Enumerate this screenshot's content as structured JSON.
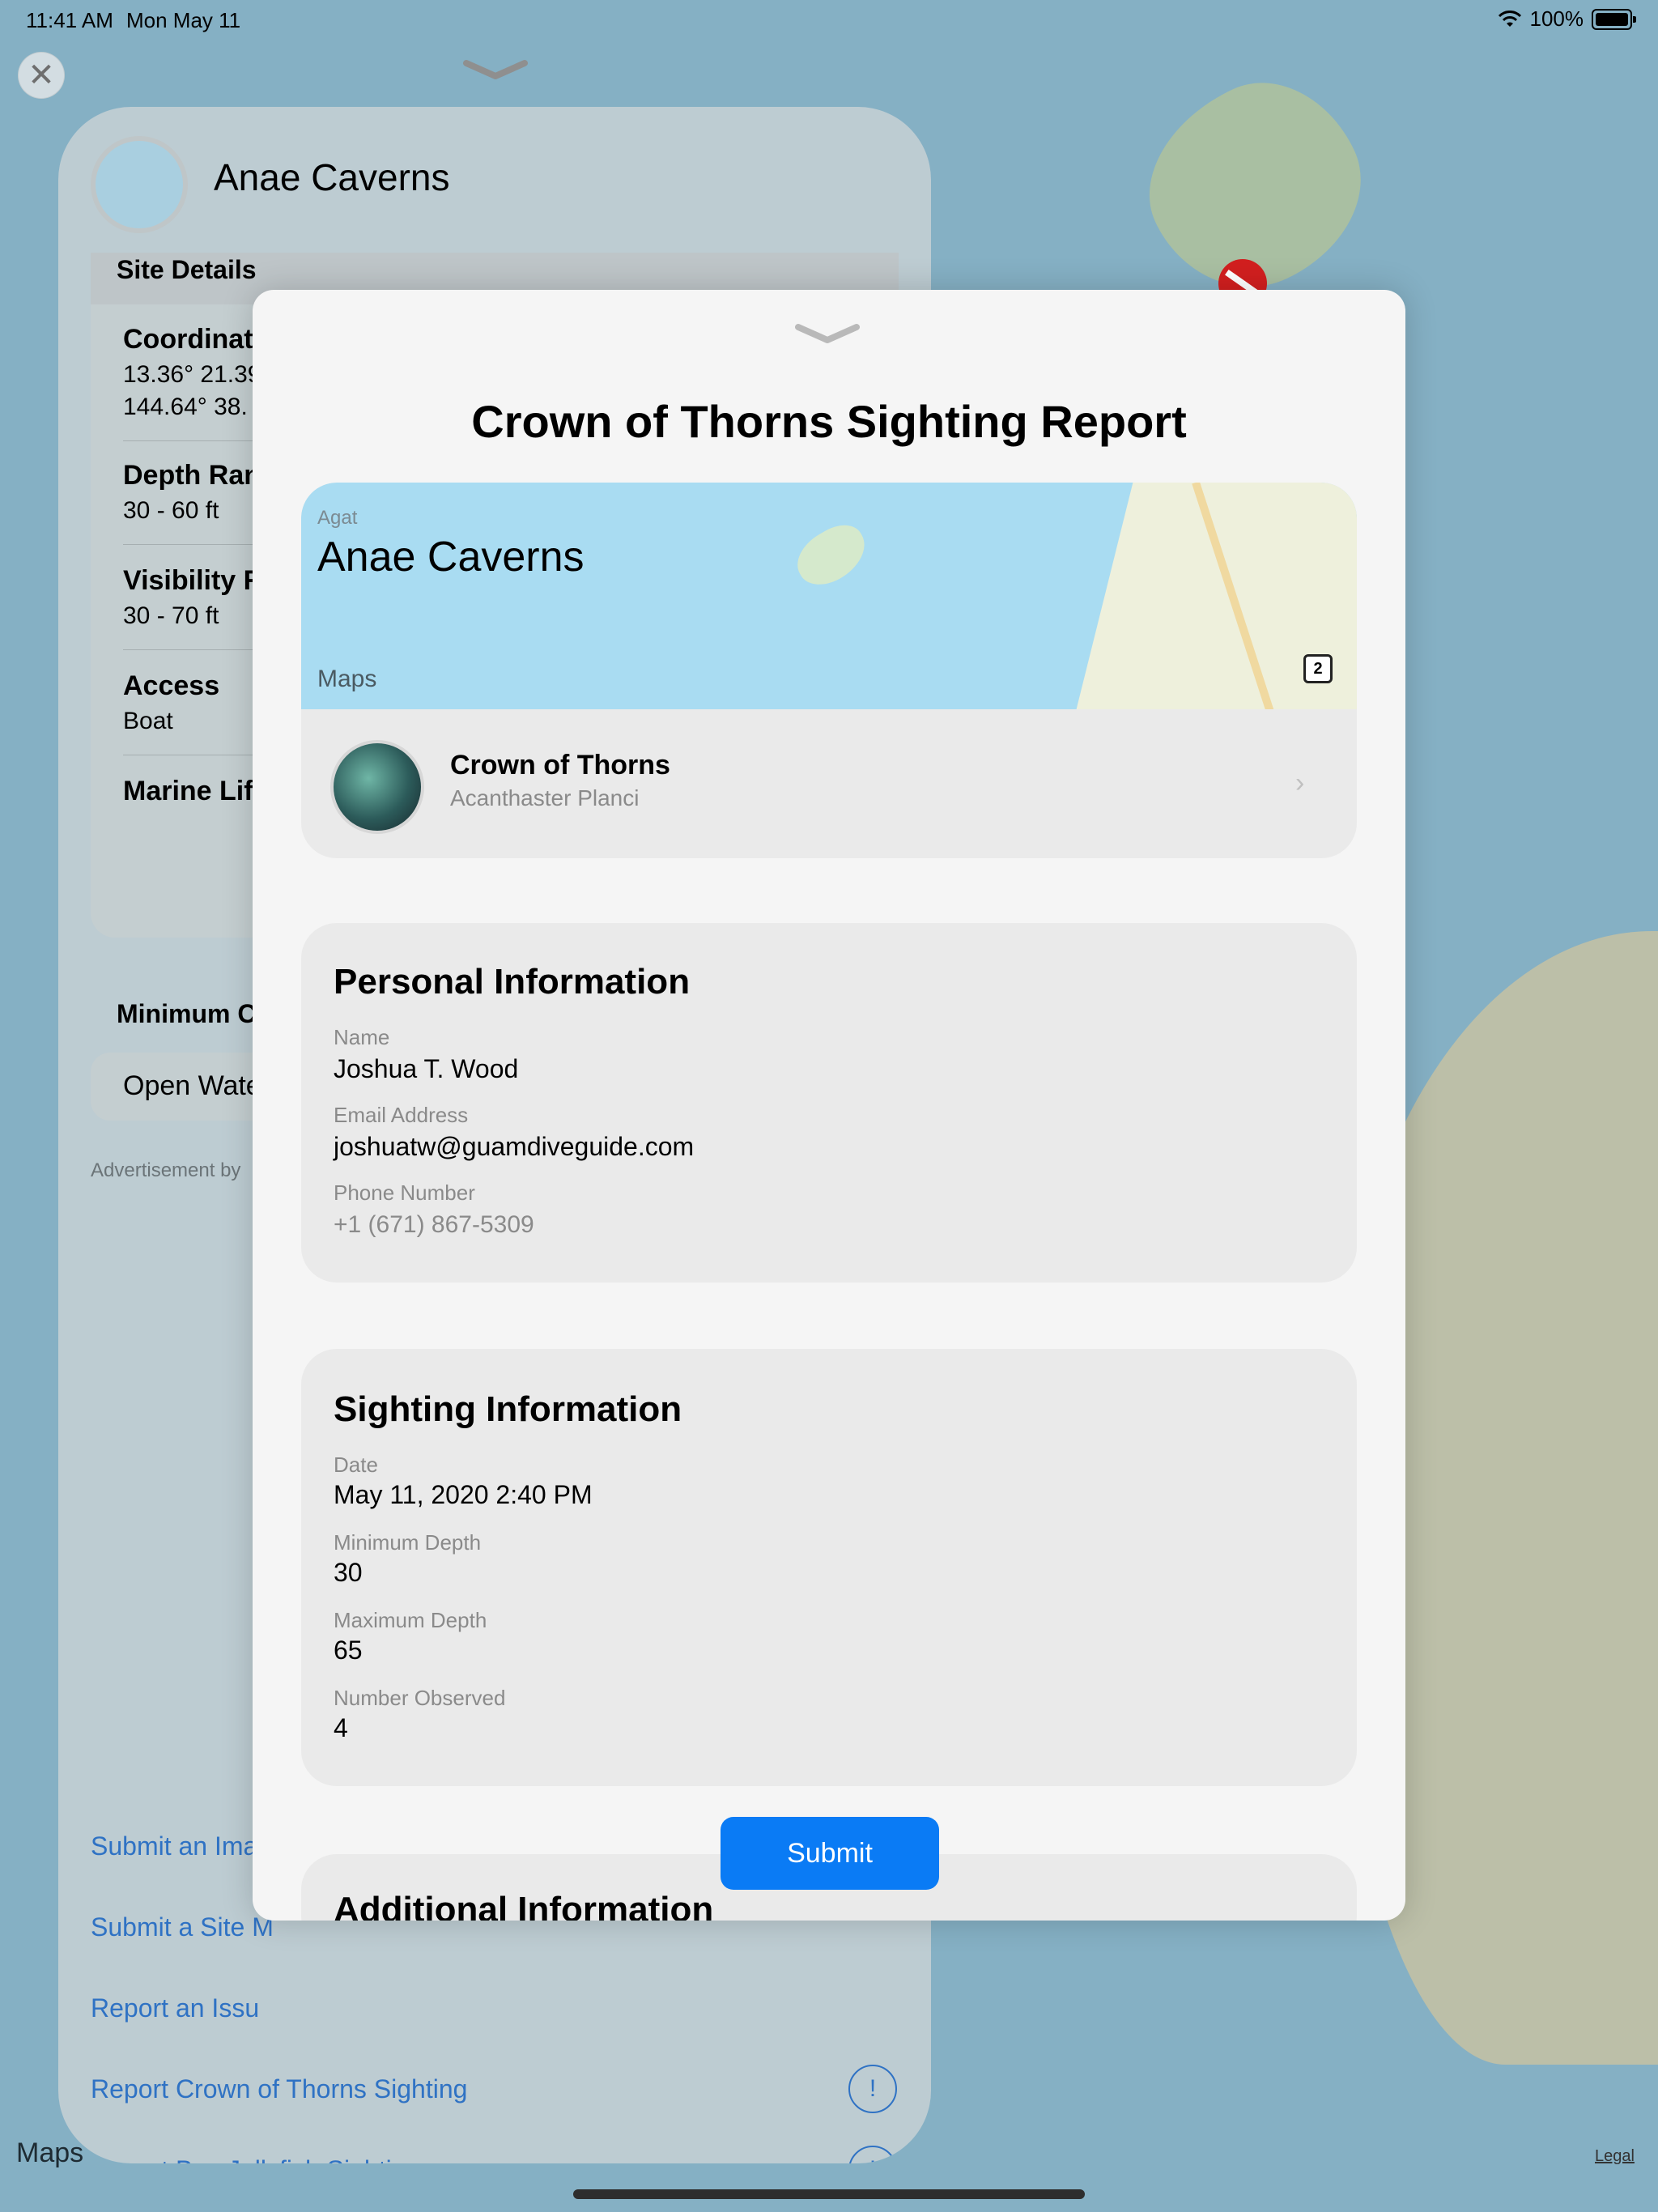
{
  "status_bar": {
    "time": "11:41 AM",
    "date": "Mon May 11",
    "battery": "100%"
  },
  "background_panel": {
    "site_name": "Anae Caverns",
    "section_header": "Site Details",
    "rows": [
      {
        "label": "Coordinate",
        "value": "13.36° 21.39",
        "value2": "144.64° 38."
      },
      {
        "label": "Depth Ran",
        "value": "30 - 60 ft"
      },
      {
        "label": "Visibility R",
        "value": "30 - 70 ft"
      },
      {
        "label": "Access",
        "value": "Boat"
      },
      {
        "label": "Marine Lif",
        "value": ""
      }
    ],
    "minimum_label": "Minimum C",
    "minimum_value": "Open Wate",
    "advertisement": "Advertisement by",
    "links": [
      "Submit an Imag",
      "Submit a Site M",
      "Report an Issu",
      "Report Crown of Thorns Sighting",
      "Report Box Jellyfish Sighting"
    ]
  },
  "sheet": {
    "title": "Crown of Thorns Sighting Report",
    "map_snapshot": {
      "region": "Agat",
      "site": "Anae Caverns",
      "maps_label": "Maps",
      "route_badge": "2"
    },
    "species": {
      "name": "Crown of Thorns",
      "scientific_name": "Acanthaster Planci"
    },
    "personal": {
      "title": "Personal Information",
      "name_label": "Name",
      "name_value": "Joshua T. Wood",
      "email_label": "Email Address",
      "email_value": "joshuatw@guamdiveguide.com",
      "phone_label": "Phone Number",
      "phone_placeholder": "+1 (671) 867-5309"
    },
    "sighting": {
      "title": "Sighting Information",
      "date_label": "Date",
      "date_value": "May 11, 2020 2:40 PM",
      "min_depth_label": "Minimum Depth",
      "min_depth_value": "30",
      "max_depth_label": "Maximum Depth",
      "max_depth_value": "65",
      "observed_label": "Number Observed",
      "observed_value": "4"
    },
    "additional_title": "Additional Information",
    "submit_label": "Submit"
  },
  "footer": {
    "maps_label": "Maps",
    "legal": "Legal"
  },
  "colors": {
    "accent": "#0a7bf5",
    "link": "#2f72c4",
    "map_water": "#85b0c4",
    "pin_red": "#d21f1f"
  }
}
